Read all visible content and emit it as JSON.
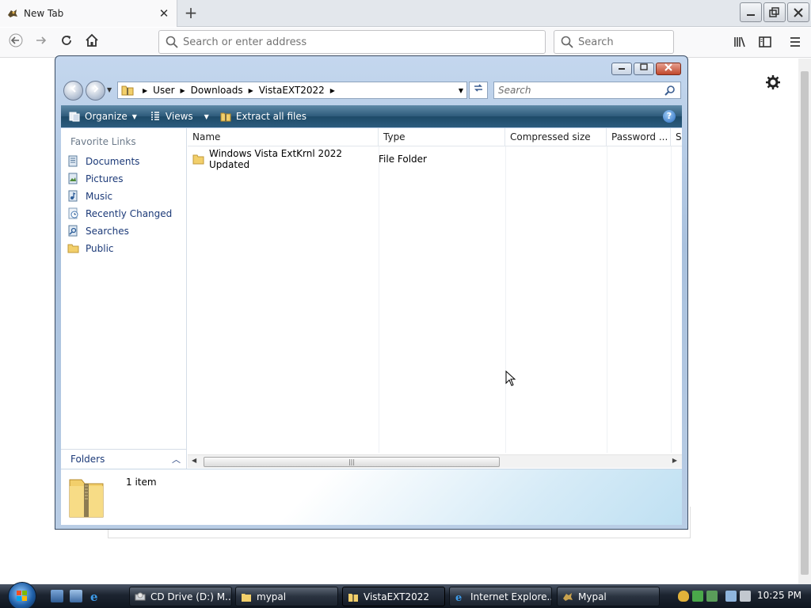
{
  "browser": {
    "tab_title": "New Tab",
    "url_placeholder": "Search or enter address",
    "search_placeholder": "Search"
  },
  "window": {
    "breadcrumbs": [
      "User",
      "Downloads",
      "VistaEXT2022"
    ],
    "search_placeholder": "Search",
    "commands": {
      "organize": "Organize",
      "views": "Views",
      "extract": "Extract all files"
    },
    "help": "?",
    "favorite_links_title": "Favorite Links",
    "favorite_links": [
      "Documents",
      "Pictures",
      "Music",
      "Recently Changed",
      "Searches",
      "Public"
    ],
    "folders_label": "Folders",
    "columns": [
      "Name",
      "Type",
      "Compressed size",
      "Password ...",
      "Si"
    ],
    "rows": [
      {
        "name": "Windows Vista ExtKrnl 2022 Updated",
        "type": "File Folder"
      }
    ],
    "status_count": "1 item"
  },
  "taskbar": {
    "buttons": [
      "CD Drive (D:) M...",
      "mypal",
      "VistaEXT2022",
      "Internet Explore...",
      "Mypal"
    ],
    "active_index": 2,
    "clock": "10:25 PM"
  }
}
